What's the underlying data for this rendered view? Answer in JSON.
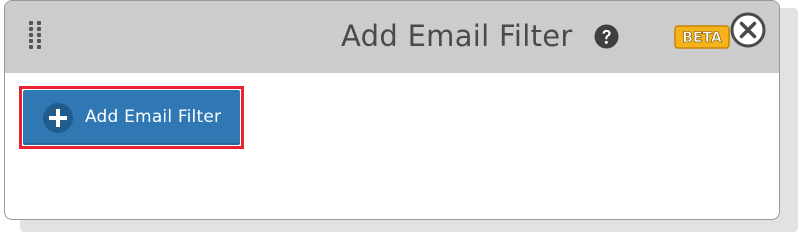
{
  "dialog": {
    "title": "Add Email Filter",
    "help_icon": "question-circle-icon",
    "badge": "BETA",
    "close_icon": "close-circle-icon",
    "drag_icon": "drag-handle-icon"
  },
  "body": {
    "add_button_label": "Add Email Filter",
    "add_button_icon": "plus-circle-icon"
  },
  "colors": {
    "header_bg": "#cccccc",
    "button_bg": "#2f78b4",
    "highlight_border": "#e8232f",
    "badge_bg": "#f5b21b"
  }
}
